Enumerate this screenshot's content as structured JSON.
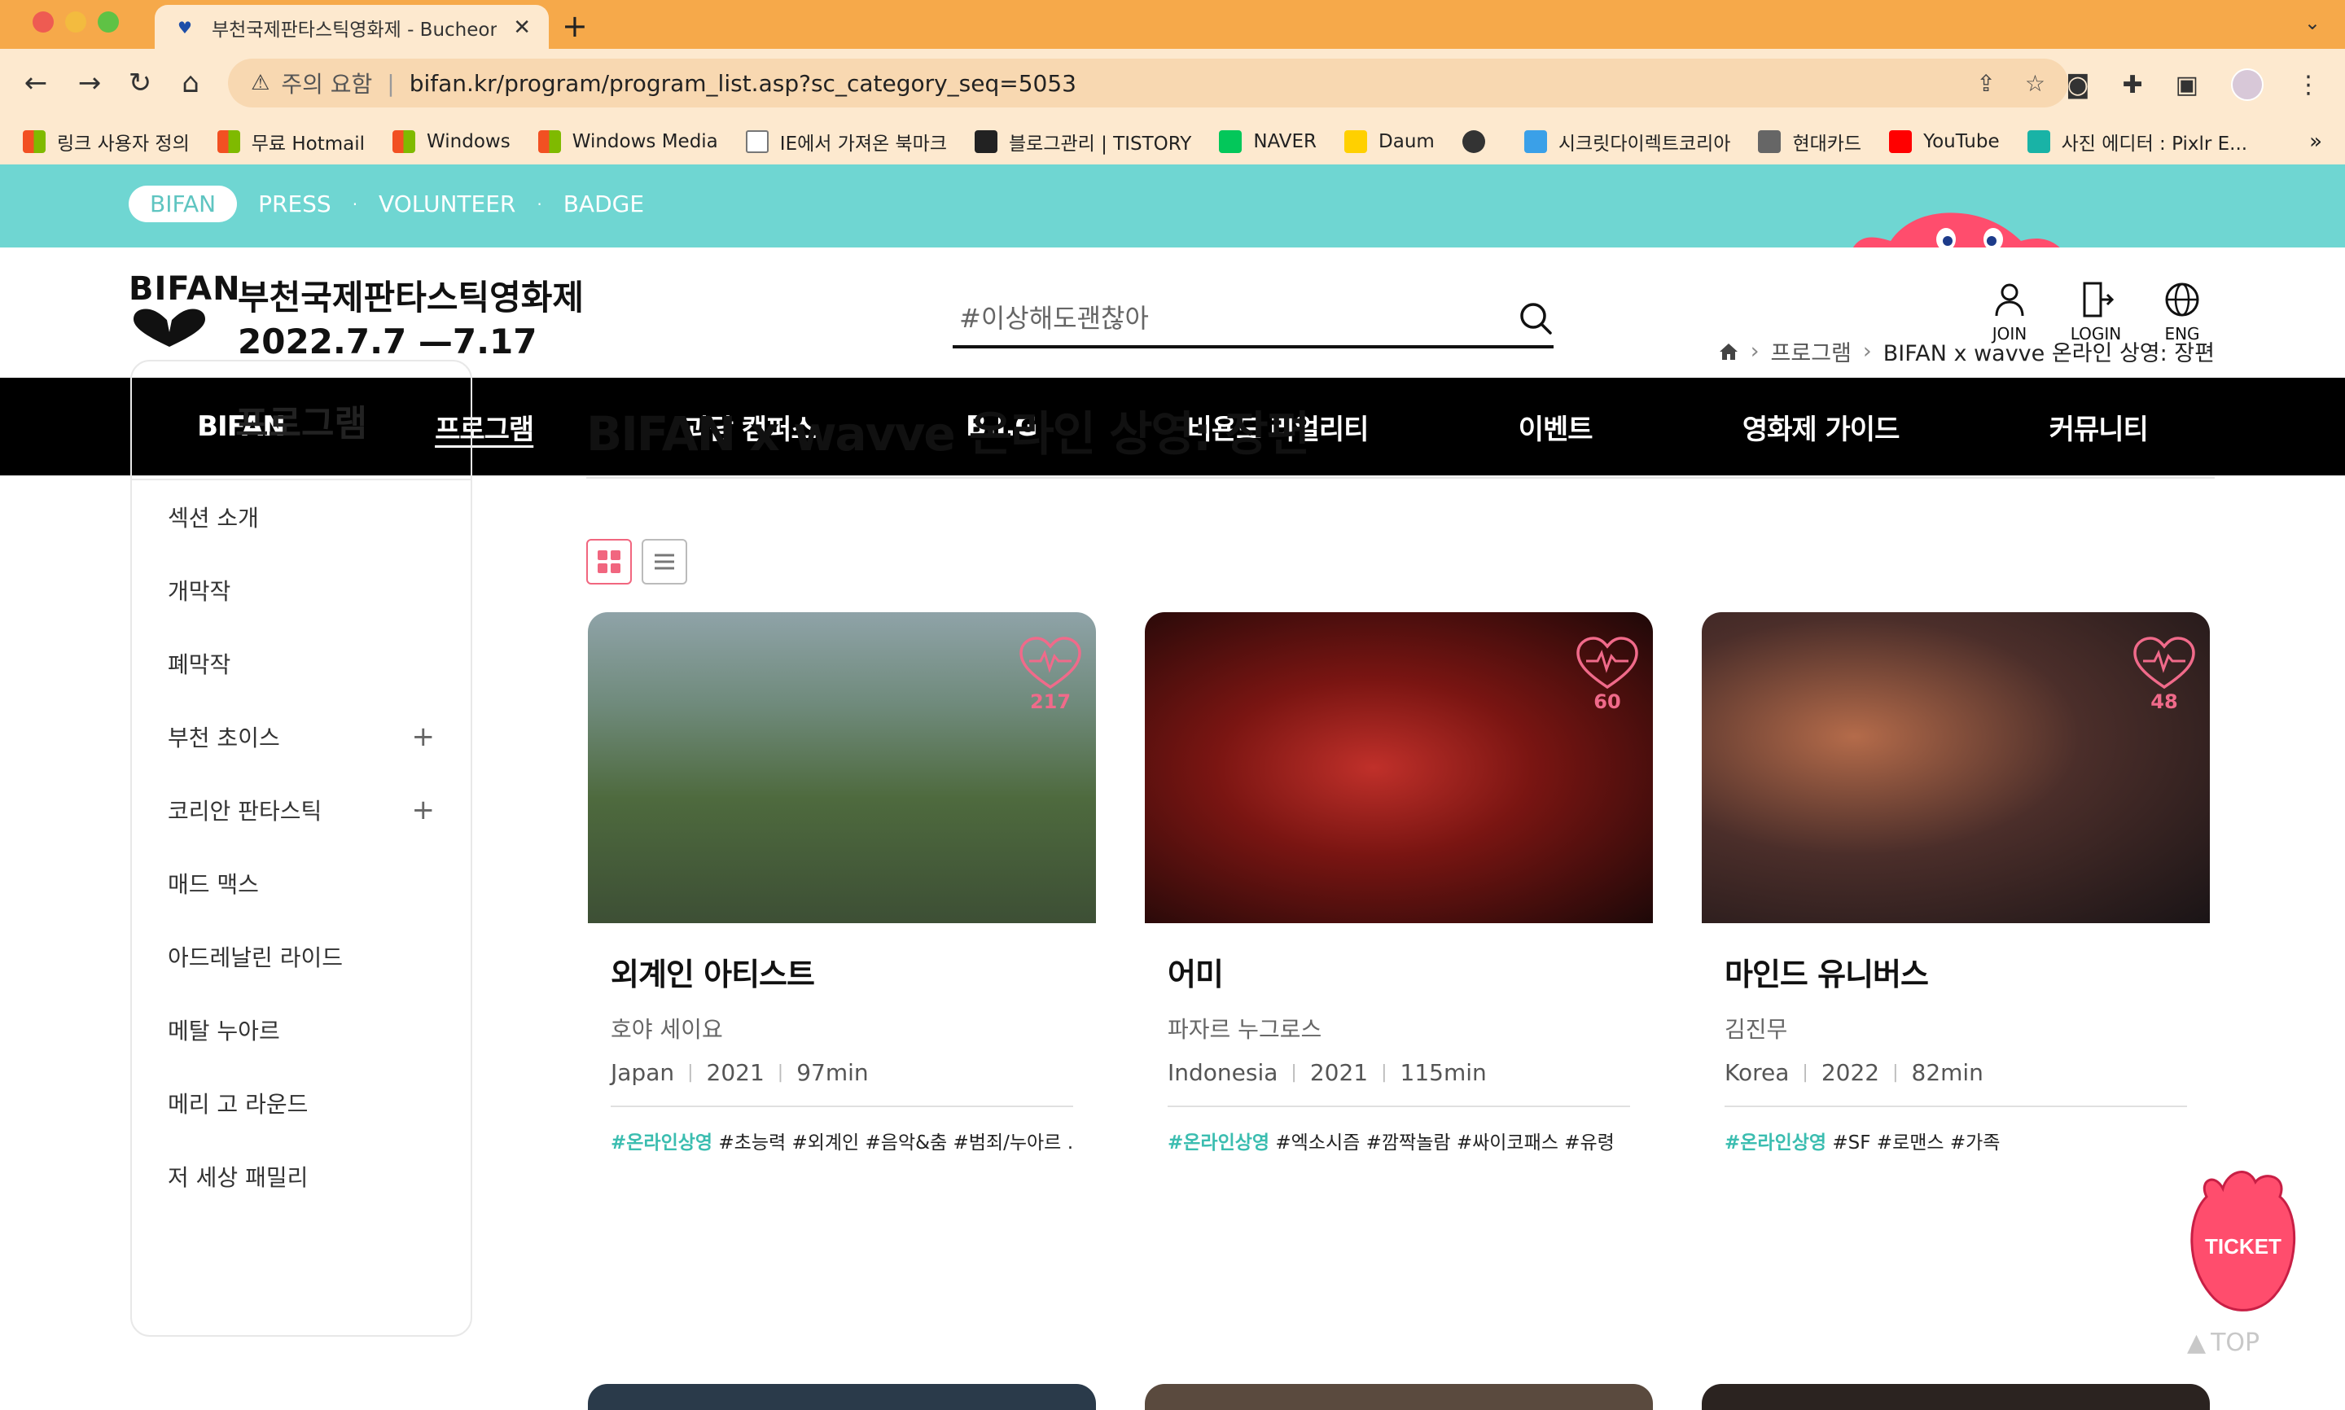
{
  "browser": {
    "tab_title": "부천국제판타스틱영화제 - Bucheon",
    "omnibox": {
      "security_label": "주의 요함",
      "url": "bifan.kr/program/program_list.asp?sc_category_seq=5053"
    },
    "bookmarks": [
      {
        "label": "링크 사용자 정의",
        "icon": "ms"
      },
      {
        "label": "무료 Hotmail",
        "icon": "ms"
      },
      {
        "label": "Windows",
        "icon": "ms"
      },
      {
        "label": "Windows Media",
        "icon": "ms"
      },
      {
        "label": "IE에서 가져온 북마크",
        "icon": "folder"
      },
      {
        "label": "블로그관리 | TISTORY",
        "icon": "tistory"
      },
      {
        "label": "NAVER",
        "icon": "naver"
      },
      {
        "label": "Daum",
        "icon": "daum"
      },
      {
        "label": "",
        "icon": "globe"
      },
      {
        "label": "시크릿다이렉트코리아",
        "icon": "secret"
      },
      {
        "label": "현대카드",
        "icon": "card"
      },
      {
        "label": "YouTube",
        "icon": "youtube"
      },
      {
        "label": "사진 에디터 : Pixlr E...",
        "icon": "pixlr"
      }
    ],
    "bookmarks_more": "»"
  },
  "topnav": {
    "active": "BIFAN",
    "items": [
      "PRESS",
      "VOLUNTEER",
      "BADGE"
    ]
  },
  "header": {
    "logo_mark": "BIFAN",
    "logo_title": "부천국제판타스틱영화제",
    "logo_date": "2022.7.7 —7.17",
    "search_placeholder": "#이상해도괜찮아",
    "join_label": "JOIN",
    "login_label": "LOGIN",
    "lang_label": "ENG"
  },
  "gnb": [
    "BIFAN",
    "프로그램",
    "괴담 캠퍼스",
    "B.I.G",
    "비욘드 리얼리티",
    "이벤트",
    "영화제 가이드",
    "커뮤니티"
  ],
  "sidebar": {
    "title": "프로그램",
    "items": [
      {
        "label": "섹션 소개",
        "expandable": false
      },
      {
        "label": "개막작",
        "expandable": false
      },
      {
        "label": "폐막작",
        "expandable": false
      },
      {
        "label": "부천 초이스",
        "expandable": true
      },
      {
        "label": "코리안 판타스틱",
        "expandable": true
      },
      {
        "label": "매드 맥스",
        "expandable": false
      },
      {
        "label": "아드레날린 라이드",
        "expandable": false
      },
      {
        "label": "메탈 누아르",
        "expandable": false
      },
      {
        "label": "메리 고 라운드",
        "expandable": false
      },
      {
        "label": "저 세상 패밀리",
        "expandable": false
      }
    ]
  },
  "breadcrumb": {
    "section": "프로그램",
    "current": "BIFAN x wavve 온라인 상영: 장편"
  },
  "page_title": "BIFAN x wavve 온라인 상영: 장편",
  "films": [
    {
      "title": "외계인 아티스트",
      "director": "호야 세이요",
      "country": "Japan",
      "year": "2021",
      "runtime": "97min",
      "likes": "217",
      "tag_accent": "#온라인상영",
      "tags": " #초능력 #외계인 #음악&춤 #범죄/누아르 …"
    },
    {
      "title": "어미",
      "director": "파자르 누그로스",
      "country": "Indonesia",
      "year": "2021",
      "runtime": "115min",
      "likes": "60",
      "tag_accent": "#온라인상영",
      "tags": " #엑소시즘 #깜짝놀람 #싸이코패스 #유령"
    },
    {
      "title": "마인드 유니버스",
      "director": "김진무",
      "country": "Korea",
      "year": "2022",
      "runtime": "82min",
      "likes": "48",
      "tag_accent": "#온라인상영",
      "tags": " #SF #로맨스 #가족"
    }
  ],
  "floating": {
    "ticket_label": "TICKET",
    "top_label": "TOP"
  },
  "colors": {
    "topbar": "#6fd6d2",
    "accent_pink": "#f1667f",
    "tag_teal": "#3bbdb0",
    "chrome": "#f6a94a"
  }
}
